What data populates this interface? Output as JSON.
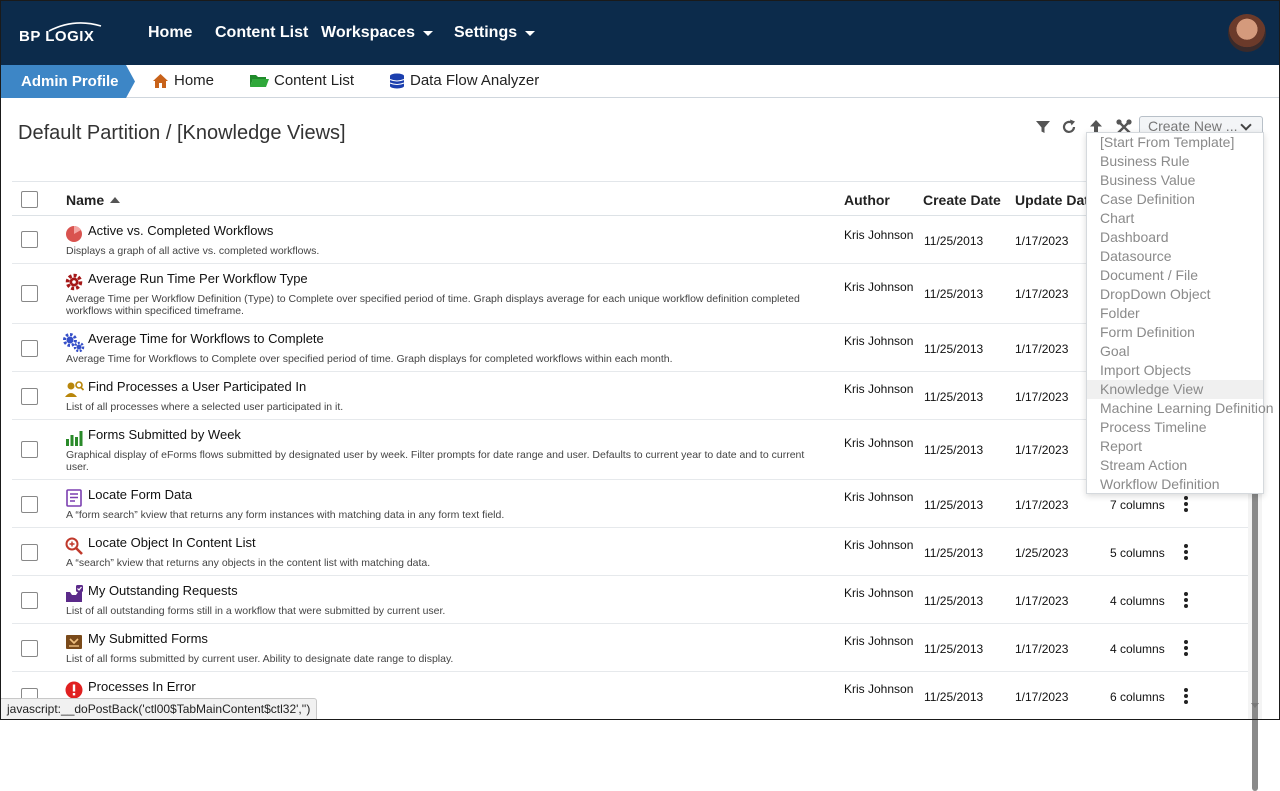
{
  "brand": {
    "logo_text": "BP LOGIX"
  },
  "topnav": {
    "items": [
      {
        "label": "Home"
      },
      {
        "label": "Content List"
      },
      {
        "label": "Workspaces"
      },
      {
        "label": "Settings"
      }
    ]
  },
  "tabbar": {
    "admin_label": "Admin Profile",
    "crumbs": [
      {
        "label": "Home",
        "icon": "home-icon"
      },
      {
        "label": "Content List",
        "icon": "folder-icon"
      },
      {
        "label": "Data Flow Analyzer",
        "icon": "database-icon"
      }
    ]
  },
  "page": {
    "title": "Default Partition / [Knowledge Views]"
  },
  "toolbar": {
    "icons": [
      "filter-icon",
      "refresh-icon",
      "upload-icon",
      "tools-icon"
    ],
    "create_new_label": "Create New ..."
  },
  "table": {
    "headers": {
      "name": "Name",
      "author": "Author",
      "create": "Create Date",
      "update": "Update Dat"
    },
    "rows": [
      {
        "name": "Active vs. Completed Workflows",
        "desc": "Displays a graph of all active vs. completed workflows.",
        "author": "Kris Johnson",
        "create": "11/25/2013",
        "update": "1/17/2023",
        "cols": "",
        "icon": "pie-chart-icon"
      },
      {
        "name": "Average Run Time Per Workflow Type",
        "desc": "Average Time per Workflow Definition (Type) to Complete over specified period of time. Graph displays average for each unique workflow definition completed workflows within specificed timeframe.",
        "author": "Kris Johnson",
        "create": "11/25/2013",
        "update": "1/17/2023",
        "cols": "",
        "icon": "gear-icon"
      },
      {
        "name": "Average Time for Workflows to Complete",
        "desc": "Average Time for Workflows to Complete over specified period of time. Graph displays for completed workflows within each month.",
        "author": "Kris Johnson",
        "create": "11/25/2013",
        "update": "1/17/2023",
        "cols": "",
        "icon": "gears-icon"
      },
      {
        "name": "Find Processes a User Participated In",
        "desc": "List of all processes where a selected user participated in it.",
        "author": "Kris Johnson",
        "create": "11/25/2013",
        "update": "1/17/2023",
        "cols": "",
        "icon": "user-search-icon"
      },
      {
        "name": "Forms Submitted by Week",
        "desc": "Graphical display of eForms flows submitted by designated user by week. Filter prompts for date range and user. Defaults to current year to date and to current user.",
        "author": "Kris Johnson",
        "create": "11/25/2013",
        "update": "1/17/2023",
        "cols": "",
        "icon": "bar-chart-icon"
      },
      {
        "name": "Locate Form Data",
        "desc": "A “form search” kview that returns any form instances with matching data in any form text field.",
        "author": "Kris Johnson",
        "create": "11/25/2013",
        "update": "1/17/2023",
        "cols": "7 columns",
        "icon": "form-icon"
      },
      {
        "name": "Locate Object In Content List",
        "desc": "A “search” kview that returns any objects in the content list with matching data.",
        "author": "Kris Johnson",
        "create": "11/25/2013",
        "update": "1/25/2023",
        "cols": "5 columns",
        "icon": "magnifier-icon"
      },
      {
        "name": "My Outstanding Requests",
        "desc": "List of all outstanding forms still in a workflow that were submitted by current user.",
        "author": "Kris Johnson",
        "create": "11/25/2013",
        "update": "1/17/2023",
        "cols": "4 columns",
        "icon": "inbox-icon"
      },
      {
        "name": "My Submitted Forms",
        "desc": "List of all forms submitted by current user. Ability to designate date range to display.",
        "author": "Kris Johnson",
        "create": "11/25/2013",
        "update": "1/17/2023",
        "cols": "4 columns",
        "icon": "submitted-icon"
      },
      {
        "name": "Processes In Error",
        "desc": "",
        "author": "Kris Johnson",
        "create": "11/25/2013",
        "update": "1/17/2023",
        "cols": "6 columns",
        "icon": "error-icon"
      }
    ]
  },
  "create_menu": {
    "items": [
      "[Start From Template]",
      "Business Rule",
      "Business Value",
      "Case Definition",
      "Chart",
      "Dashboard",
      "Datasource",
      "Document / File",
      "DropDown Object",
      "Folder",
      "Form Definition",
      "Goal",
      "Import Objects",
      "Knowledge View",
      "Machine Learning Definition",
      "Process Timeline",
      "Report",
      "Stream Action",
      "Workflow Definition"
    ],
    "highlighted": "Knowledge View"
  },
  "statusbar": {
    "text": "javascript:__doPostBack('ctl00$TabMainContent$ctl32','')"
  },
  "colors": {
    "nav_bg": "#0c2b4b",
    "admin_tab": "#3d86c6",
    "error_red": "#e02020"
  }
}
